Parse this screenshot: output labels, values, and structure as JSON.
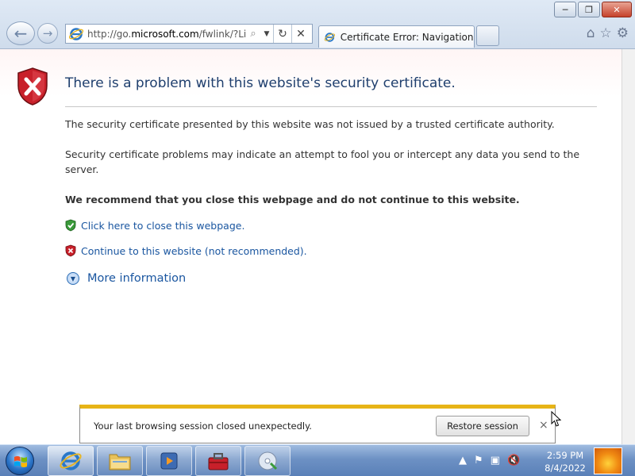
{
  "browser": {
    "url_domain_prefix": "http://go.",
    "url_domain": "microsoft.com",
    "url_path": "/fwlink/?LinkI",
    "tab_title": "Certificate Error: Navigation ...",
    "window_controls": {
      "minimize": "─",
      "maximize": "❐",
      "close": "✕"
    },
    "toolbar_icons": [
      "home-icon",
      "favorites-star-icon",
      "tools-gear-icon"
    ]
  },
  "page": {
    "title": "There is a problem with this website's security certificate.",
    "paragraph1": "The security certificate presented by this website was not issued by a trusted certificate authority.",
    "paragraph2": "Security certificate problems may indicate an attempt to fool you or intercept any data you send to the server.",
    "recommendation": "We recommend that you close this webpage and do not continue to this website.",
    "close_link": "Click here to close this webpage.",
    "continue_link": "Continue to this website (not recommended).",
    "more_info": "More information"
  },
  "notification": {
    "message": "Your last browsing session closed unexpectedly.",
    "restore_button": "Restore session",
    "close_glyph": "×"
  },
  "taskbar": {
    "time": "2:59 PM",
    "date": "8/4/2022",
    "pinned": [
      "internet-explorer-icon",
      "explorer-folder-icon",
      "media-player-icon",
      "toolbox-app-icon",
      "disc-app-icon"
    ]
  },
  "colors": {
    "title_blue": "#1f3f6e",
    "link_blue": "#1a56a0",
    "error_red": "#c8202a",
    "safe_green": "#3a9a3a",
    "notif_yellow": "#e7b416"
  }
}
